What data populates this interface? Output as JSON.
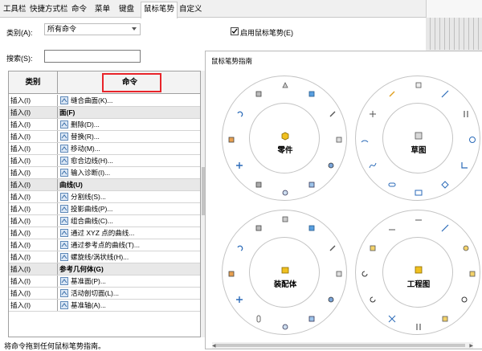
{
  "tabs": [
    "工具栏",
    "快捷方式栏",
    "命令",
    "菜单",
    "键盘",
    "鼠标笔势",
    "自定义"
  ],
  "active_tab": 5,
  "category_label": "类别(A):",
  "category_value": "所有命令",
  "search_label": "搜索(S):",
  "search_value": "",
  "enable_gestures_label": "启用鼠标笔势(E)",
  "enable_gestures_checked": true,
  "table": {
    "col_category": "类别",
    "col_command": "命令",
    "rows": [
      {
        "cat": "插入(I)",
        "cmd": "缝合曲面(K)...",
        "group": false,
        "icon": "knit-surface-icon"
      },
      {
        "cat": "插入(I)",
        "cmd": "面(F)",
        "group": true
      },
      {
        "cat": "插入(I)",
        "cmd": "删除(D)...",
        "group": false,
        "icon": "delete-face-icon"
      },
      {
        "cat": "插入(I)",
        "cmd": "替换(R)...",
        "group": false,
        "icon": "replace-face-icon"
      },
      {
        "cat": "插入(I)",
        "cmd": "移动(M)...",
        "group": false,
        "icon": "move-face-icon"
      },
      {
        "cat": "插入(I)",
        "cmd": "愈合边线(H)...",
        "group": false,
        "icon": "heal-edges-icon"
      },
      {
        "cat": "插入(I)",
        "cmd": "输入诊断(I)...",
        "group": false,
        "icon": "import-diagnostics-icon"
      },
      {
        "cat": "插入(I)",
        "cmd": "曲线(U)",
        "group": true
      },
      {
        "cat": "插入(I)",
        "cmd": "分割线(S)...",
        "group": false,
        "icon": "split-line-icon"
      },
      {
        "cat": "插入(I)",
        "cmd": "投影曲线(P)...",
        "group": false,
        "icon": "projected-curve-icon"
      },
      {
        "cat": "插入(I)",
        "cmd": "组合曲线(C)...",
        "group": false,
        "icon": "composite-curve-icon"
      },
      {
        "cat": "插入(I)",
        "cmd": "通过 XYZ 点的曲线...",
        "group": false,
        "icon": "curve-xyz-icon"
      },
      {
        "cat": "插入(I)",
        "cmd": "通过参考点的曲线(T)...",
        "group": false,
        "icon": "curve-reference-points-icon"
      },
      {
        "cat": "插入(I)",
        "cmd": "螺旋线/涡状线(H)...",
        "group": false,
        "icon": "helix-icon"
      },
      {
        "cat": "插入(I)",
        "cmd": "参考几何体(G)",
        "group": true
      },
      {
        "cat": "插入(I)",
        "cmd": "基准面(P)...",
        "group": false,
        "icon": "plane-icon"
      },
      {
        "cat": "插入(I)",
        "cmd": "活动剖切面(L)...",
        "group": false,
        "icon": "live-section-icon"
      },
      {
        "cat": "插入(I)",
        "cmd": "基准轴(A)...",
        "group": false,
        "icon": "axis-icon"
      }
    ]
  },
  "status_text": "将命令拖到任何鼠标笔势指南。",
  "guide": {
    "title": "鼠标笔势指南",
    "wheels": [
      "零件",
      "草图",
      "装配体",
      "工程图"
    ]
  }
}
